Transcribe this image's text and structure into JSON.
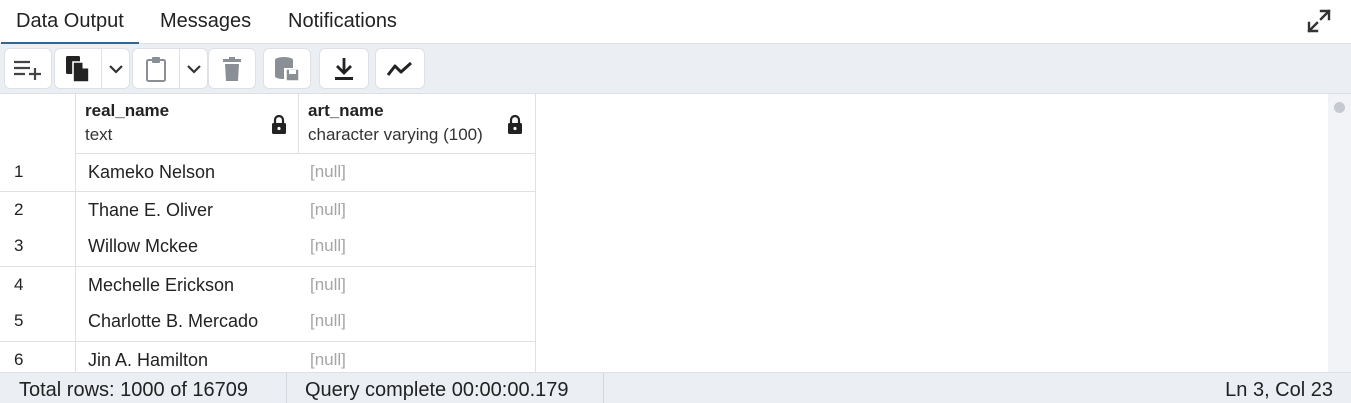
{
  "tabs": [
    {
      "label": "Data Output",
      "active": true
    },
    {
      "label": "Messages",
      "active": false
    },
    {
      "label": "Notifications",
      "active": false
    }
  ],
  "toolbar": {
    "icons": [
      "add-row-icon",
      "copy-icon",
      "chevron-down-icon",
      "paste-icon",
      "chevron-down-icon",
      "delete-icon",
      "save-data-icon",
      "download-icon",
      "graph-icon"
    ]
  },
  "columns": [
    {
      "name": "real_name",
      "type": "text",
      "locked": true
    },
    {
      "name": "art_name",
      "type": "character varying (100)",
      "locked": true
    }
  ],
  "rows": [
    {
      "num": "1",
      "real_name": "Kameko Nelson",
      "art_name": "[null]"
    },
    {
      "num": "2",
      "real_name": "Thane E. Oliver",
      "art_name": "[null]"
    },
    {
      "num": "3",
      "real_name": "Willow Mckee",
      "art_name": "[null]"
    },
    {
      "num": "4",
      "real_name": "Mechelle Erickson",
      "art_name": "[null]"
    },
    {
      "num": "5",
      "real_name": "Charlotte B. Mercado",
      "art_name": "[null]"
    },
    {
      "num": "6",
      "real_name": "Jin A. Hamilton",
      "art_name": "[null]"
    }
  ],
  "status": {
    "total_rows": "Total rows: 1000 of 16709",
    "query": "Query complete 00:00:00.179",
    "cursor": "Ln 3, Col 23"
  },
  "colors": {
    "accent": "#326690",
    "null_text": "#a5a5a5",
    "toolbar_bg": "#ebeef3"
  }
}
